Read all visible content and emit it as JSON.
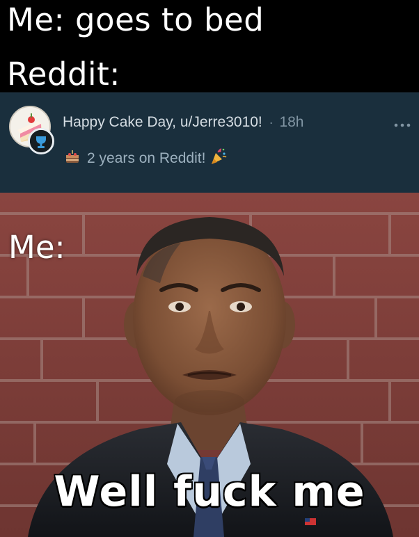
{
  "meme": {
    "top_caption": {
      "line1": "Me: goes to bed",
      "line2": "Reddit:"
    },
    "notification": {
      "title": "Happy Cake Day, u/Jerre3010!",
      "separator": "·",
      "time_ago": "18h",
      "subtitle": "2 years on Reddit!",
      "avatar_icon": "cake-slice-icon",
      "badge_icon": "trophy-icon",
      "subtitle_icon": "cake-icon",
      "celebration_icon": "party-popper-icon",
      "more_icon": "more-options-icon",
      "background_color": "#1a2f3d"
    },
    "panel_label": "Me:",
    "bottom_caption": "Well fuck me"
  }
}
